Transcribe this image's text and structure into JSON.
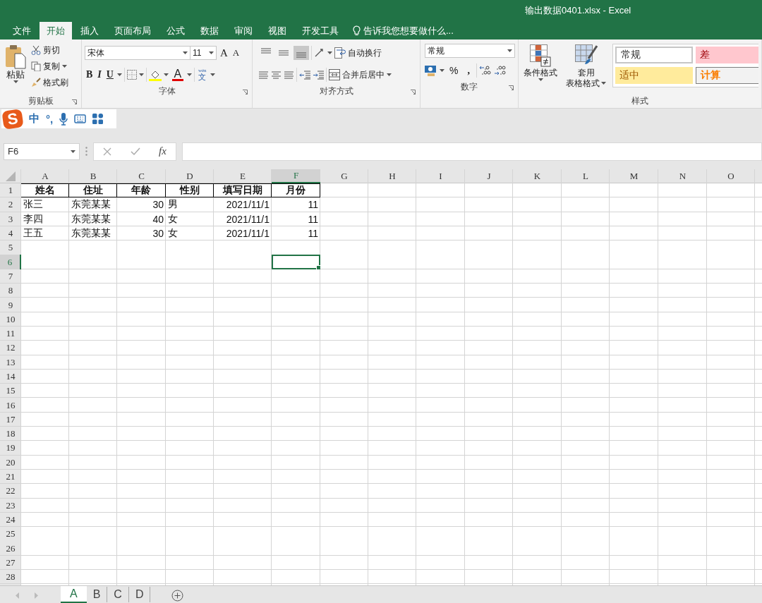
{
  "window": {
    "title": "输出数据0401.xlsx - Excel"
  },
  "ribbon_tabs": [
    {
      "label": "文件",
      "selected": false
    },
    {
      "label": "开始",
      "selected": true
    },
    {
      "label": "插入",
      "selected": false
    },
    {
      "label": "页面布局",
      "selected": false
    },
    {
      "label": "公式",
      "selected": false
    },
    {
      "label": "数据",
      "selected": false
    },
    {
      "label": "审阅",
      "selected": false
    },
    {
      "label": "视图",
      "selected": false
    },
    {
      "label": "开发工具",
      "selected": false
    }
  ],
  "tell_me": "告诉我您想要做什么...",
  "clipboard": {
    "paste": "粘贴",
    "cut": "剪切",
    "copy": "复制",
    "format_painter": "格式刷",
    "label": "剪贴板"
  },
  "font": {
    "name": "宋体",
    "size": "11",
    "grow": "A",
    "shrink": "A",
    "bold": "B",
    "italic": "I",
    "underline": "U",
    "font_color": "A",
    "phonetic_top": "wén",
    "phonetic": "文",
    "label": "字体"
  },
  "alignment": {
    "vertical": [
      {
        "selected": false
      },
      {
        "selected": false
      },
      {
        "selected": true
      }
    ],
    "wrap_text": "自动换行",
    "merge_center": "合并后居中",
    "label": "对齐方式"
  },
  "number": {
    "format": "常规",
    "percent": "%",
    "comma": ",",
    "label": "数字"
  },
  "styles": {
    "conditional": "条件格式",
    "table_top": "套用",
    "table_bottom": "表格格式",
    "gallery": [
      {
        "label": "常规",
        "color": "#ffffff"
      },
      {
        "label": "差",
        "color": "#ffc7ce"
      },
      {
        "label": "适中",
        "color": "#ffeb9c"
      },
      {
        "label": "计算",
        "color": "#f2f2f2"
      }
    ],
    "label": "样式"
  },
  "ime": {
    "logo": "S",
    "items": [
      "中",
      "°,"
    ]
  },
  "name_box": "F6",
  "function_label": "fx",
  "sheet": {
    "columns": [
      {
        "label": "A",
        "selected": false
      },
      {
        "label": "B",
        "selected": false
      },
      {
        "label": "C",
        "selected": false
      },
      {
        "label": "D",
        "selected": false
      },
      {
        "label": "E",
        "selected": false
      },
      {
        "label": "F",
        "selected": true
      },
      {
        "label": "G",
        "selected": false
      },
      {
        "label": "H",
        "selected": false
      },
      {
        "label": "I",
        "selected": false
      },
      {
        "label": "J",
        "selected": false
      },
      {
        "label": "K",
        "selected": false
      },
      {
        "label": "L",
        "selected": false
      },
      {
        "label": "M",
        "selected": false
      },
      {
        "label": "N",
        "selected": false
      },
      {
        "label": "O",
        "selected": false
      }
    ],
    "rows": [
      {
        "label": "1",
        "selected": false,
        "kind": "header",
        "cells": [
          {
            "text": "姓名",
            "kind": "text"
          },
          {
            "text": "住址",
            "kind": "text"
          },
          {
            "text": "年龄",
            "kind": "text"
          },
          {
            "text": "性别",
            "kind": "text"
          },
          {
            "text": "填写日期",
            "kind": "text"
          },
          {
            "text": "月份",
            "kind": "text"
          }
        ]
      },
      {
        "label": "2",
        "selected": false,
        "kind": "data",
        "cells": [
          {
            "text": "张三",
            "kind": "text"
          },
          {
            "text": "东莞某某",
            "kind": "text"
          },
          {
            "text": "30",
            "kind": "number"
          },
          {
            "text": "男",
            "kind": "text"
          },
          {
            "text": "2021/11/1",
            "kind": "number"
          },
          {
            "text": "11",
            "kind": "number"
          }
        ]
      },
      {
        "label": "3",
        "selected": false,
        "kind": "data",
        "cells": [
          {
            "text": "李四",
            "kind": "text"
          },
          {
            "text": "东莞某某",
            "kind": "text"
          },
          {
            "text": "40",
            "kind": "number"
          },
          {
            "text": "女",
            "kind": "text"
          },
          {
            "text": "2021/11/1",
            "kind": "number"
          },
          {
            "text": "11",
            "kind": "number"
          }
        ]
      },
      {
        "label": "4",
        "selected": false,
        "kind": "data",
        "cells": [
          {
            "text": "王五",
            "kind": "text"
          },
          {
            "text": "东莞某某",
            "kind": "text"
          },
          {
            "text": "30",
            "kind": "number"
          },
          {
            "text": "女",
            "kind": "text"
          },
          {
            "text": "2021/11/1",
            "kind": "number"
          },
          {
            "text": "11",
            "kind": "number"
          }
        ]
      },
      {
        "label": "5",
        "selected": false
      },
      {
        "label": "6",
        "selected": true
      },
      {
        "label": "7",
        "selected": false
      },
      {
        "label": "8",
        "selected": false
      },
      {
        "label": "9",
        "selected": false
      },
      {
        "label": "10",
        "selected": false
      },
      {
        "label": "11",
        "selected": false
      },
      {
        "label": "12",
        "selected": false
      },
      {
        "label": "13",
        "selected": false
      },
      {
        "label": "14",
        "selected": false
      },
      {
        "label": "15",
        "selected": false
      },
      {
        "label": "16",
        "selected": false
      },
      {
        "label": "17",
        "selected": false
      },
      {
        "label": "18",
        "selected": false
      },
      {
        "label": "19",
        "selected": false
      },
      {
        "label": "20",
        "selected": false
      },
      {
        "label": "21",
        "selected": false
      },
      {
        "label": "22",
        "selected": false
      },
      {
        "label": "23",
        "selected": false
      },
      {
        "label": "24",
        "selected": false
      },
      {
        "label": "25",
        "selected": false
      },
      {
        "label": "26",
        "selected": false
      },
      {
        "label": "27",
        "selected": false
      },
      {
        "label": "28",
        "selected": false
      }
    ]
  },
  "sheet_tabs": [
    {
      "label": "A",
      "selected": true
    },
    {
      "label": "B",
      "selected": false
    },
    {
      "label": "C",
      "selected": false
    },
    {
      "label": "D",
      "selected": false
    }
  ]
}
